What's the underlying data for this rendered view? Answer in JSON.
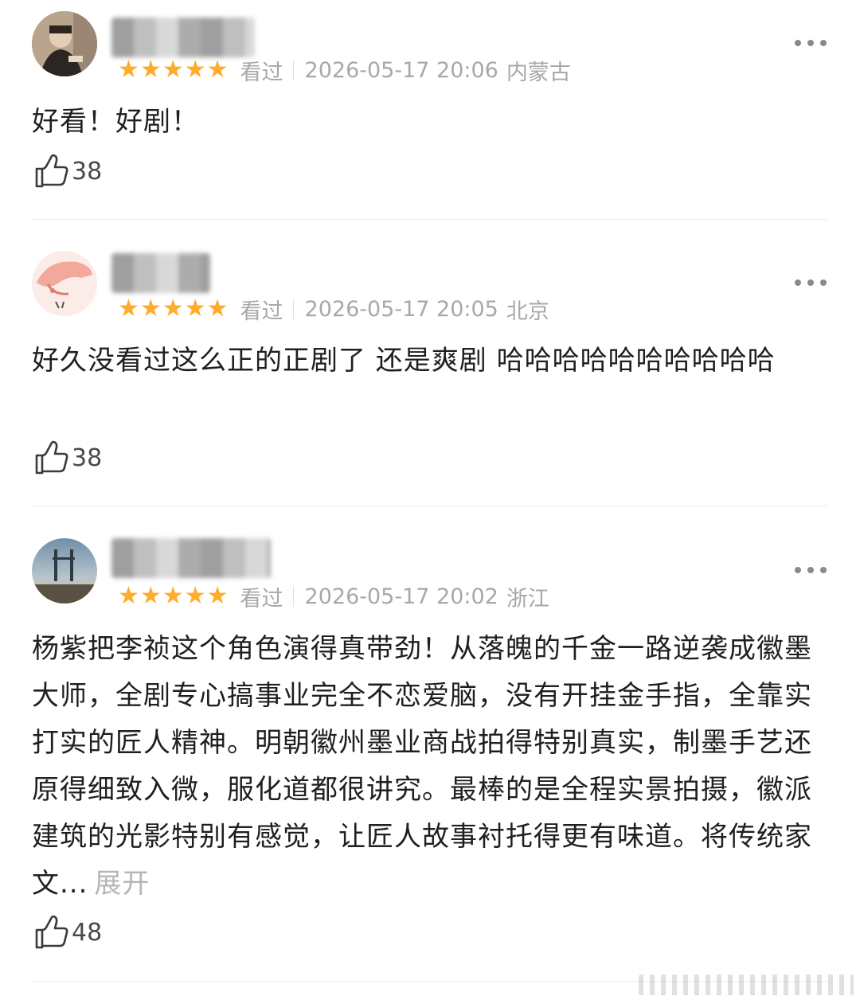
{
  "reviews": [
    {
      "avatar": "user-photo-avatar",
      "rating": 5,
      "status": "看过",
      "datetime": "2026-05-17 20:06",
      "location": "内蒙古",
      "text": "好看！好剧！",
      "likes": "38"
    },
    {
      "avatar": "cartoon-avatar",
      "rating": 5,
      "status": "看过",
      "datetime": "2026-05-17 20:05",
      "location": "北京",
      "text": "好久没看过这么正的正剧了 还是爽剧 哈哈哈哈哈哈哈哈哈哈",
      "likes": "38"
    },
    {
      "avatar": "landscape-avatar",
      "rating": 5,
      "status": "看过",
      "datetime": "2026-05-17 20:02",
      "location": "浙江",
      "text": "杨紫把李祯这个角色演得真带劲！从落魄的千金一路逆袭成徽墨大师，全剧专心搞事业完全不恋爱脑，没有开挂金手指，全靠实打实的匠人精神。明朝徽州墨业商战拍得特别真实，制墨手艺还原得细致入微，服化道都很讲究。最棒的是全程实景拍摄，徽派建筑的光影特别有感觉，让匠人故事衬托得更有味道。将传统家文...",
      "expand_label": "展开",
      "likes": "48"
    }
  ],
  "icons": {
    "rating": "star-icon",
    "like": "thumbs-up-icon",
    "more": "more-dots-icon"
  },
  "colors": {
    "star": "#ffac2d",
    "meta_text": "#a8a8a8",
    "divider": "#ececec"
  }
}
